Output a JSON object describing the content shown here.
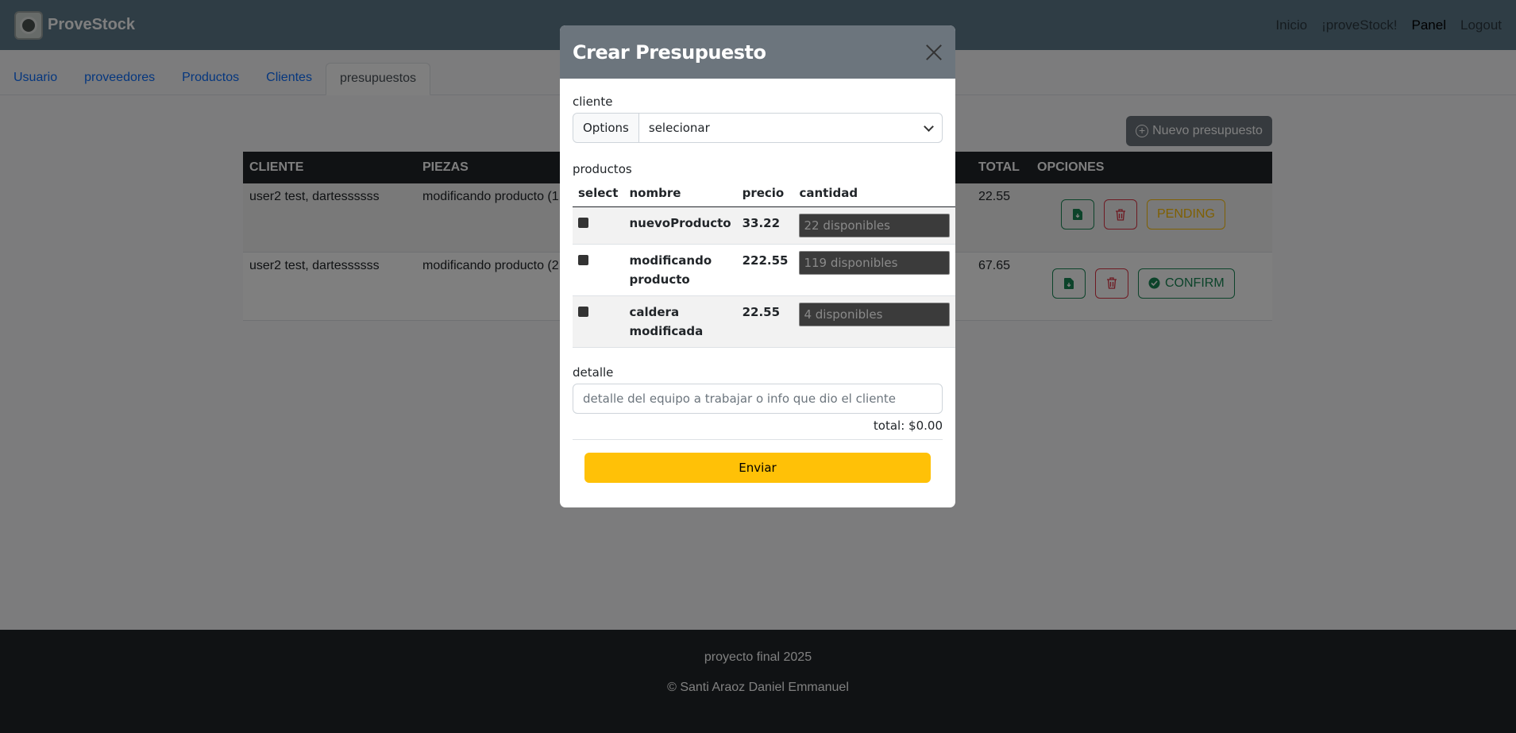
{
  "navbar": {
    "brand": "ProveStock",
    "links": [
      "Inicio",
      "¡proveStock!",
      "Panel",
      "Logout"
    ]
  },
  "tabs": [
    "Usuario",
    "proveedores",
    "Productos",
    "Clientes",
    "presupuestos"
  ],
  "new_button": "Nuevo presupuesto",
  "table": {
    "headers": [
      "Cliente",
      "Piezas",
      "Total",
      "Opciones"
    ],
    "rows": [
      {
        "cliente": "user2 test, dartessssss",
        "piezas": "modificando producto (1",
        "total": "22.55",
        "status": "PENDING"
      },
      {
        "cliente": "user2 test, dartessssss",
        "piezas": "modificando producto (2",
        "total": "67.65",
        "status": "CONFIRM"
      }
    ]
  },
  "footer": {
    "line1": "proyecto final 2025",
    "line2": "© Santi Araoz Daniel Emmanuel"
  },
  "modal": {
    "title": "Crear Presupuesto",
    "cliente_label": "cliente",
    "options_label": "Options",
    "select_value": "selecionar",
    "productos_label": "productos",
    "columns": [
      "select",
      "nombre",
      "precio",
      "cantidad"
    ],
    "products": [
      {
        "nombre": "nuevoProducto",
        "precio": "33.22",
        "cantidad_placeholder": "22 disponibles"
      },
      {
        "nombre": "modificando producto",
        "precio": "222.55",
        "cantidad_placeholder": "119 disponibles"
      },
      {
        "nombre": "caldera modificada",
        "precio": "22.55",
        "cantidad_placeholder": "4 disponibles"
      }
    ],
    "detalle_label": "detalle",
    "detalle_placeholder": "detalle del equipo a trabajar o info que dio el cliente",
    "total": "total: $0.00",
    "submit_label": "Enviar"
  },
  "colors": {
    "navbar": "#5e7a8a",
    "modal_header": "#6c757d",
    "submit": "#ffc107",
    "pending": "#ffc107",
    "confirm": "#198754",
    "delete": "#dc3545"
  }
}
